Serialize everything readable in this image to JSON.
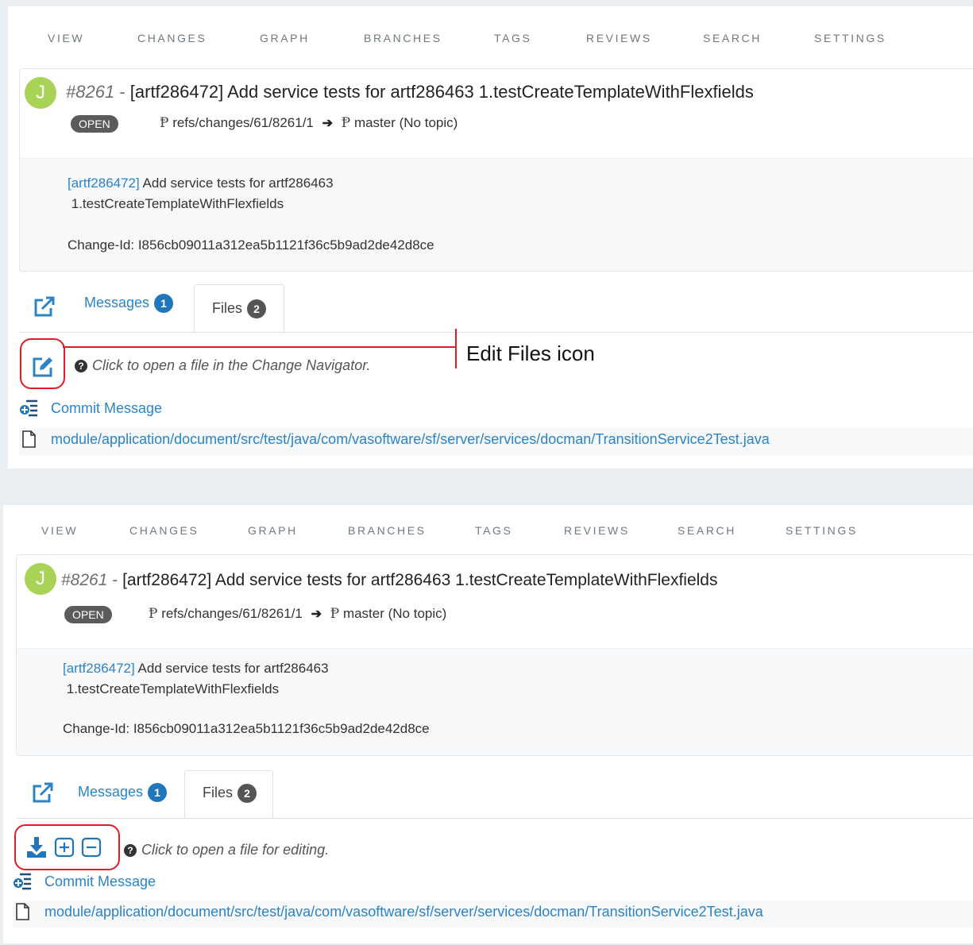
{
  "nav": [
    "VIEW",
    "CHANGES",
    "GRAPH",
    "BRANCHES",
    "TAGS",
    "REVIEWS",
    "SEARCH",
    "SETTINGS"
  ],
  "change": {
    "avatar_initial": "J",
    "number": "#8261",
    "separator": "-",
    "title": "[artf286472] Add service tests for artf286463 1.testCreateTemplateWithFlexfields",
    "status": "OPEN",
    "source_ref": "refs/changes/61/8261/1",
    "target_ref": "master (No topic)",
    "commit_tag": "[artf286472]",
    "commit_line1_rest": " Add service tests for artf286463",
    "commit_line2": "1.testCreateTemplateWithFlexfields",
    "change_id": "Change-Id: I856cb09011a312ea5b1121f36c5b9ad2de42d8ce"
  },
  "tabs": {
    "messages_label": "Messages",
    "messages_count": "1",
    "files_label": "Files",
    "files_count": "2"
  },
  "panel1": {
    "hint": "Click to open a file in the Change Navigator.",
    "annotation": "Edit Files icon"
  },
  "panel2": {
    "hint": "Click to open a file for editing."
  },
  "files": {
    "commit_message": "Commit Message",
    "file_path": "module/application/document/src/test/java/com/vasoftware/sf/server/services/docman/TransitionService2Test.java"
  },
  "colors": {
    "link": "#2b84c6",
    "highlight": "#e21b2b",
    "avatar": "#a9d356",
    "badge_blue": "#1f76ba"
  },
  "icons": [
    "external-link-icon",
    "edit-icon",
    "download-icon",
    "expand-all-icon",
    "collapse-all-icon",
    "commit-message-icon",
    "file-icon",
    "branch-icon",
    "arrow-right-icon",
    "question-icon"
  ]
}
